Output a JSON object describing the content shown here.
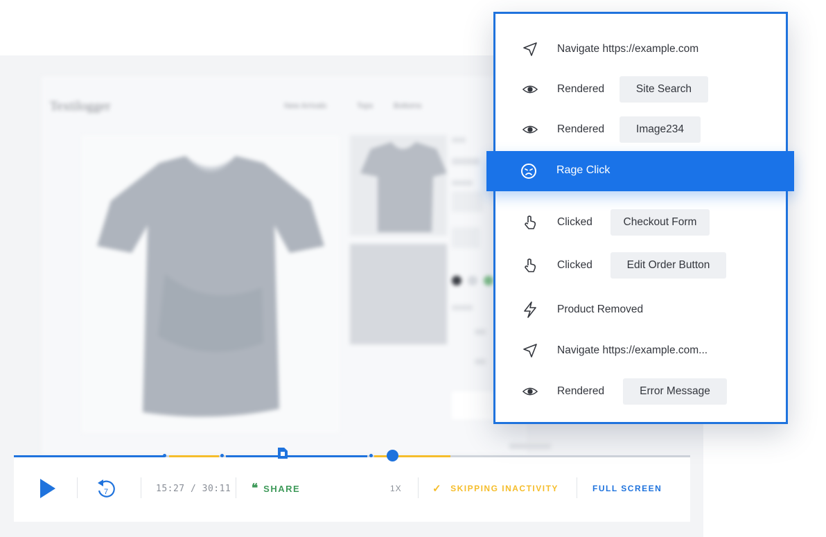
{
  "site": {
    "logo": "Textilogger",
    "nav": [
      "New Arrivals",
      "Tops",
      "Bottoms"
    ]
  },
  "player": {
    "time": "15:27 / 30:11",
    "share_label": "SHARE",
    "speed_label": "1X",
    "skip_label": "SKIPPING INACTIVITY",
    "fullscreen_label": "FULL SCREEN",
    "rewind_seconds": "7"
  },
  "events": [
    {
      "icon": "navigate-icon",
      "label": "Navigate https://example.com",
      "chip": ""
    },
    {
      "icon": "eye-icon",
      "label": "Rendered",
      "chip": "Site Search"
    },
    {
      "icon": "eye-icon",
      "label": "Rendered",
      "chip": "Image234"
    },
    {
      "icon": "rage-face-icon",
      "label": "Rage Click",
      "chip": ""
    },
    {
      "icon": "pointer-hand-icon",
      "label": "Clicked",
      "chip": "Checkout Form"
    },
    {
      "icon": "pointer-hand-icon",
      "label": "Clicked",
      "chip": "Edit Order Button"
    },
    {
      "icon": "lightning-icon",
      "label": "Product Removed",
      "chip": ""
    },
    {
      "icon": "navigate-icon",
      "label": "Navigate https://example.com...",
      "chip": ""
    },
    {
      "icon": "eye-icon",
      "label": "Rendered",
      "chip": "Error Message"
    }
  ],
  "colors": {
    "accent": "#1f73dd",
    "rage_highlight": "#1a73e8",
    "share_green": "#3f9a5a",
    "skip_yellow": "#f5bd2b",
    "track_gray": "#cfd4db"
  }
}
